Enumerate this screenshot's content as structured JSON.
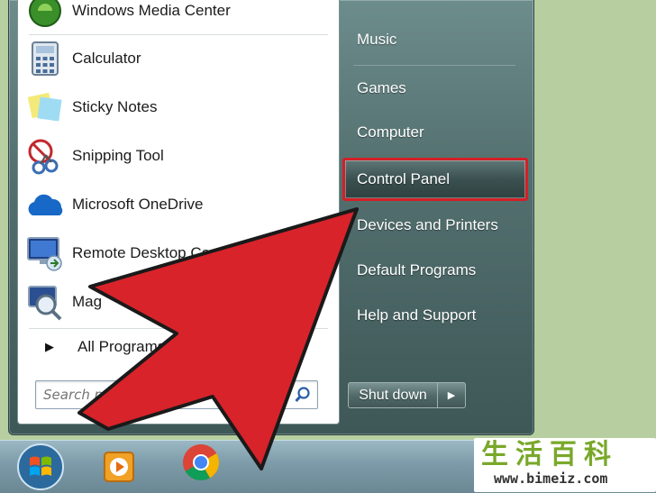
{
  "start_menu": {
    "programs": [
      {
        "label": "Windows Media Center",
        "icon": "windows-media-center-icon"
      },
      {
        "label": "Calculator",
        "icon": "calculator-icon"
      },
      {
        "label": "Sticky Notes",
        "icon": "sticky-notes-icon"
      },
      {
        "label": "Snipping Tool",
        "icon": "snipping-tool-icon"
      },
      {
        "label": "Microsoft OneDrive",
        "icon": "onedrive-icon"
      },
      {
        "label": "Remote Desktop Co",
        "icon": "remote-desktop-icon"
      },
      {
        "label": "Mag",
        "icon": "magnifier-icon"
      }
    ],
    "all_programs_label": "All Programs",
    "search_placeholder": "Search p",
    "search_tail_text": "fle",
    "right_items": [
      {
        "label": "Music"
      },
      {
        "label": "Games"
      },
      {
        "label": "Computer"
      },
      {
        "label": "Control Panel",
        "selected": true
      },
      {
        "label": "Devices and Printers"
      },
      {
        "label": "Default Programs"
      },
      {
        "label": "Help and Support"
      }
    ],
    "shutdown_label": "Shut down"
  },
  "taskbar": {
    "items": [
      "start-orb",
      "media-player-icon",
      "chrome-icon"
    ]
  },
  "annotation": {
    "arrow_color": "#d8232a",
    "highlight_color": "#d41f26"
  },
  "watermark": {
    "chars": [
      "生",
      "活",
      "百",
      "科"
    ],
    "url": "www.bimeiz.com"
  }
}
